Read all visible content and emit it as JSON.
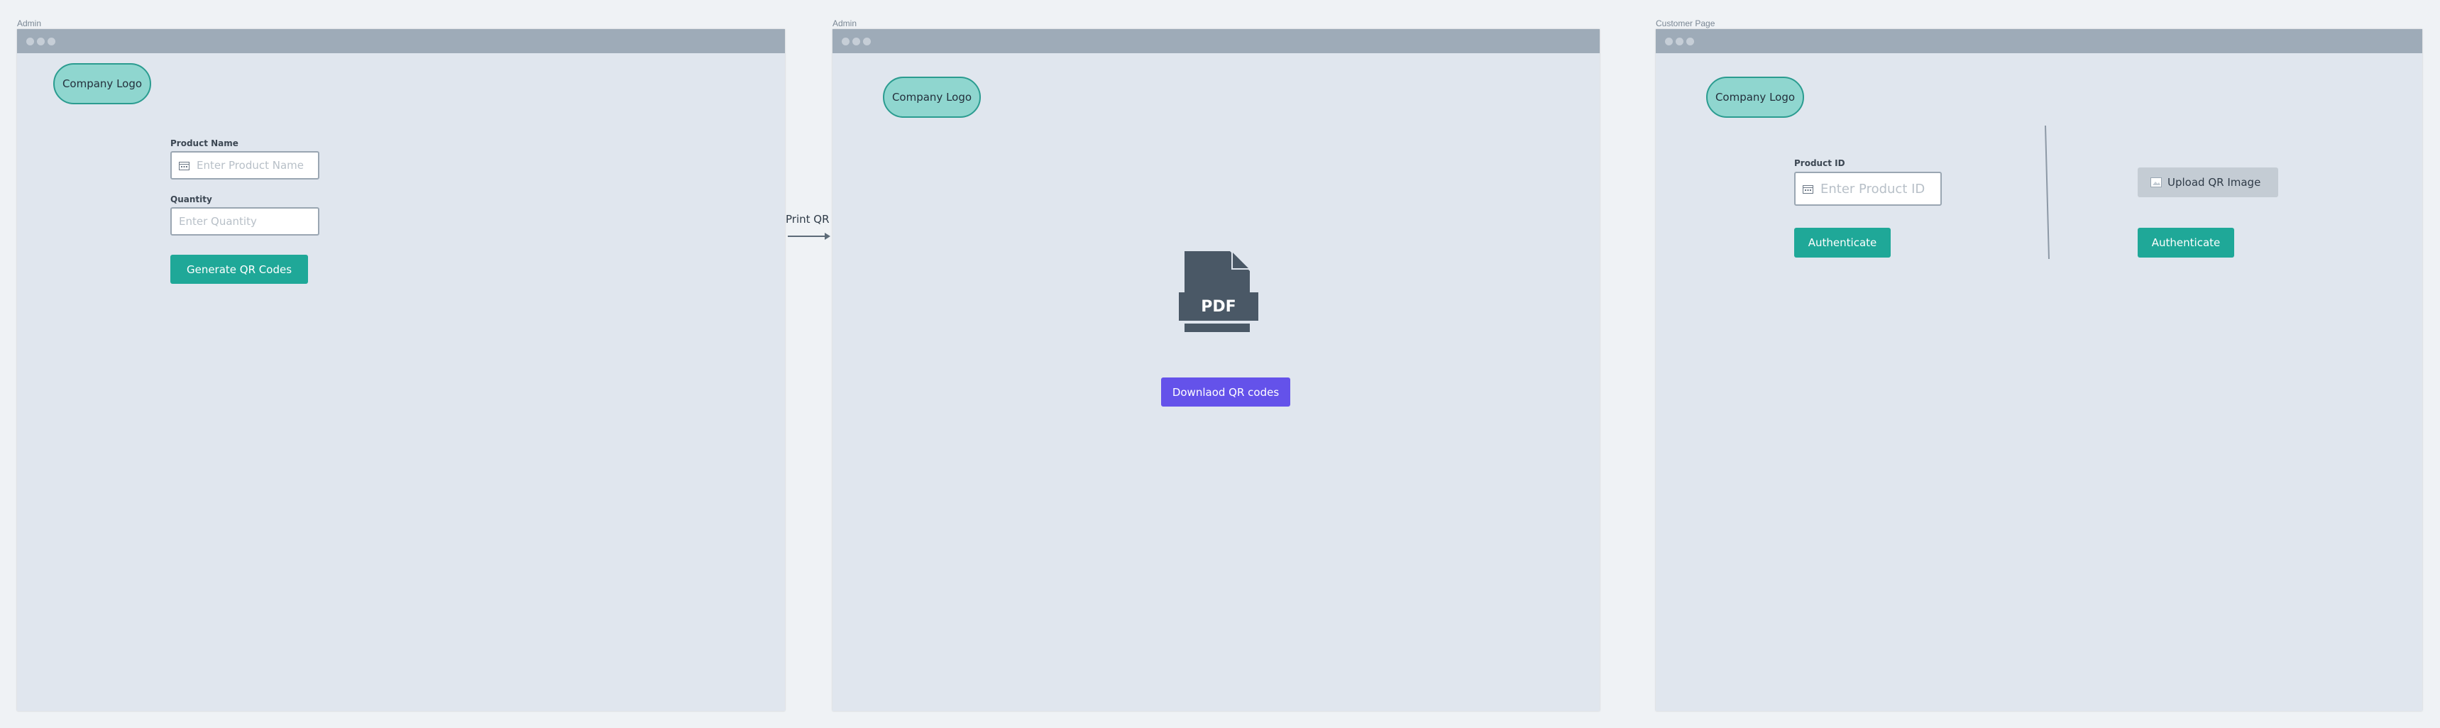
{
  "frames": [
    {
      "label": "Admin",
      "logo": "Company Logo",
      "form": {
        "product_name_label": "Product Name",
        "product_name_placeholder": "Enter Product Name",
        "quantity_label": "Quantity",
        "quantity_placeholder": "Enter Quantity",
        "generate_button": "Generate QR Codes"
      }
    },
    {
      "label": "Admin",
      "logo": "Company Logo",
      "pdf_text": "PDF",
      "download_button": "Downlaod QR codes"
    },
    {
      "label": "Customer Page",
      "logo": "Company Logo",
      "product_id_label": "Product ID",
      "product_id_placeholder": "Enter Product ID",
      "authenticate_left": "Authenticate",
      "upload_button": "Upload QR Image",
      "authenticate_right": "Authenticate"
    }
  ],
  "flow_arrow": {
    "label": "Print QR"
  },
  "icons": {
    "window_controls": "dots",
    "input_icon": "calendar-icon",
    "document_icon": "pdf-file-icon",
    "upload_icon": "image-icon"
  },
  "colors": {
    "teal_button": "#1fa898",
    "purple_button": "#6452ea",
    "logo_fill": "#8fd6cf",
    "logo_border": "#2b9c90",
    "titlebar": "#9eabb8",
    "canvas": "#e0e6ee",
    "pdf_icon": "#4a5866"
  }
}
